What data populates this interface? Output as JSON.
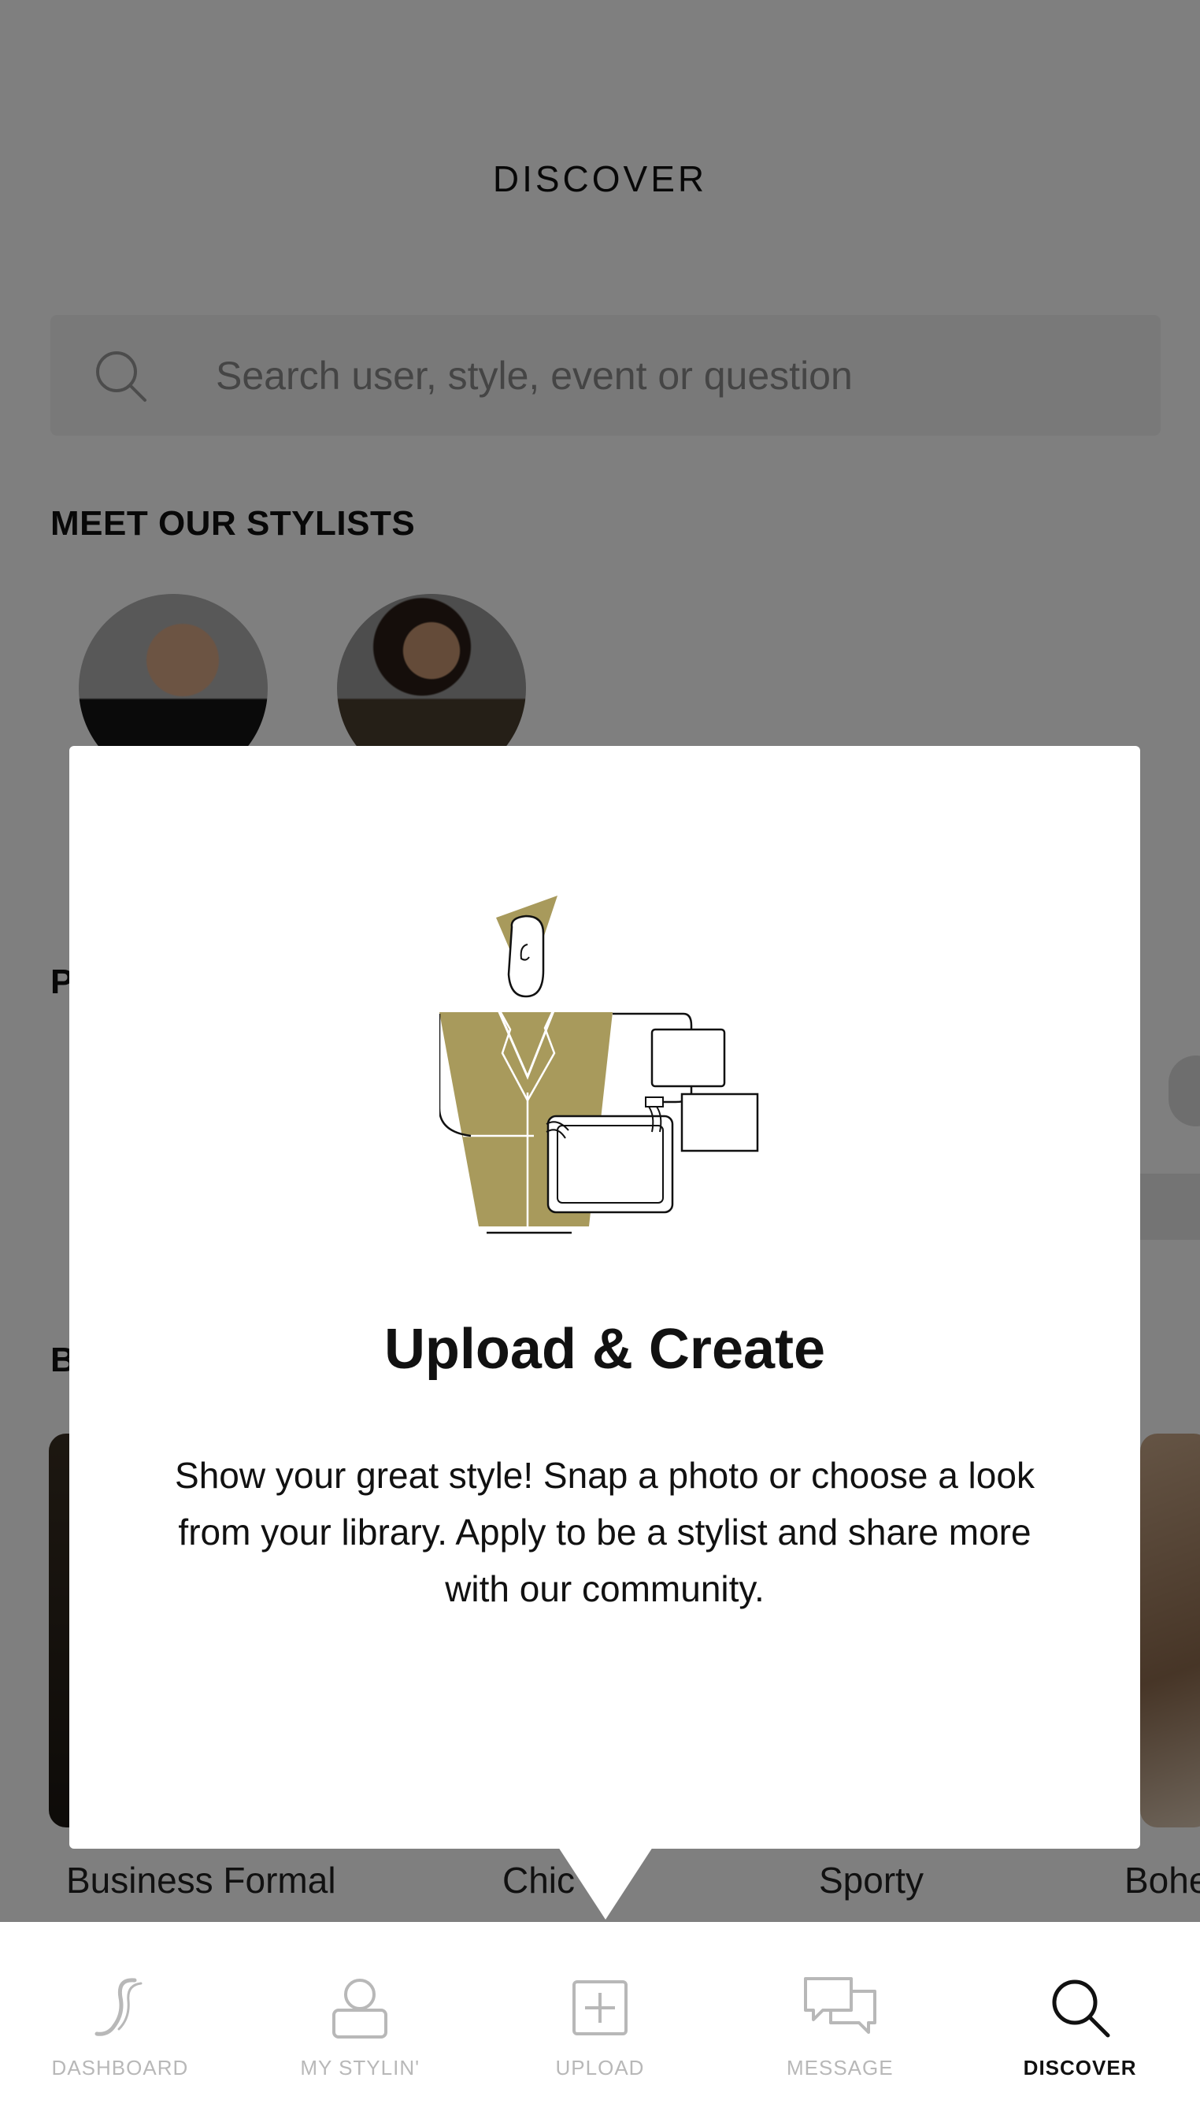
{
  "page": {
    "title": "DISCOVER",
    "search": {
      "placeholder": "Search user, style, event or question"
    },
    "stylists_heading": "MEET OUR STYLISTS",
    "partial_heading_1": "P",
    "partial_heading_2": "B",
    "style_labels": [
      "Business Formal",
      "Chic",
      "Sporty",
      "Bohe"
    ]
  },
  "modal": {
    "title": "Upload & Create",
    "body": "Show your great style! Snap a photo or choose a look from your library. Apply to be a stylist and share more with our community.",
    "accent_color": "#a89a5c"
  },
  "bottom_nav": {
    "items": [
      {
        "label": "DASHBOARD",
        "icon": "stylin-logo-icon",
        "active": false
      },
      {
        "label": "MY STYLIN'",
        "icon": "profile-icon",
        "active": false
      },
      {
        "label": "UPLOAD",
        "icon": "plus-square-icon",
        "active": false
      },
      {
        "label": "MESSAGE",
        "icon": "chat-bubbles-icon",
        "active": false
      },
      {
        "label": "DISCOVER",
        "icon": "search-icon",
        "active": true
      }
    ]
  }
}
